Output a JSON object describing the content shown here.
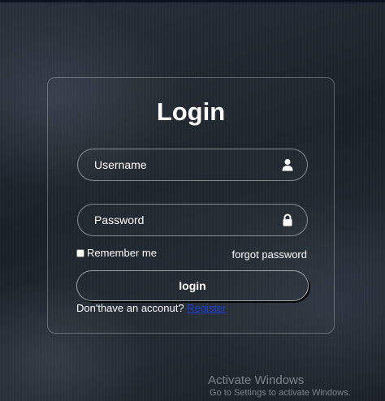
{
  "login": {
    "title": "Login",
    "username_placeholder": "Username",
    "password_placeholder": "Password",
    "remember_label": "Remember me",
    "forgot_label": "forgot password",
    "button_label": "login",
    "register_prompt": "Don'thave an acconut?",
    "register_link": "Register",
    "icons": {
      "username": "user-icon",
      "password": "lock-icon"
    }
  },
  "watermark": {
    "title": "Activate Windows",
    "subtitle": "Go to Settings to activate Windows."
  },
  "colors": {
    "background": "#1e252e",
    "text": "#ffffff",
    "link": "#1e3fd9"
  }
}
